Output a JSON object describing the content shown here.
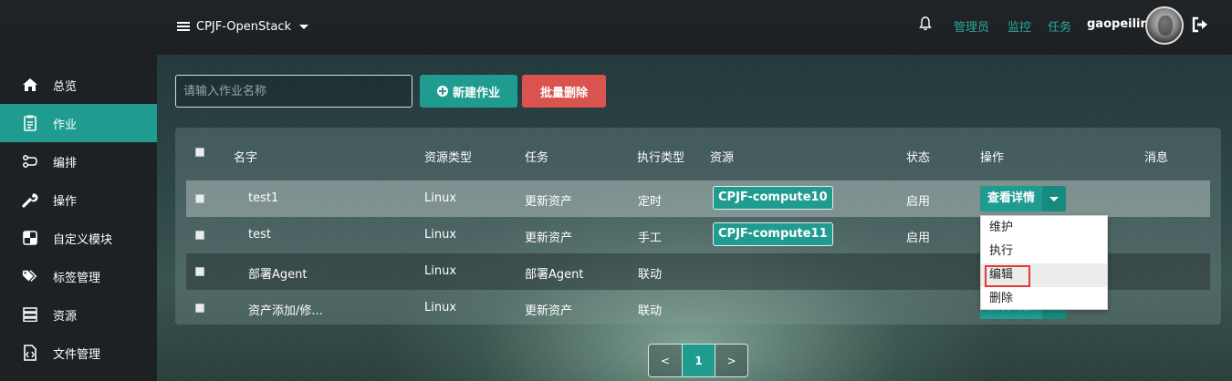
{
  "header": {
    "project_name": "CPJF-OpenStack",
    "links": [
      "管理员",
      "监控",
      "任务"
    ],
    "username": "gaopeilin"
  },
  "sidebar": {
    "items": [
      {
        "label": "总览",
        "icon": "home-icon"
      },
      {
        "label": "作业",
        "icon": "clipboard-icon",
        "active": true
      },
      {
        "label": "编排",
        "icon": "flow-icon"
      },
      {
        "label": "操作",
        "icon": "wrench-icon"
      },
      {
        "label": "自定义模块",
        "icon": "puzzle-icon"
      },
      {
        "label": "标签管理",
        "icon": "tags-icon"
      },
      {
        "label": "资源",
        "icon": "server-icon"
      },
      {
        "label": "文件管理",
        "icon": "file-code-icon"
      }
    ]
  },
  "toolbar": {
    "search_placeholder": "请输入作业名称",
    "new_label": "新建作业",
    "batch_delete_label": "批量删除"
  },
  "table": {
    "headers": {
      "name": "名字",
      "resource_type": "资源类型",
      "task": "任务",
      "exec_type": "执行类型",
      "resource": "资源",
      "status": "状态",
      "action": "操作",
      "message": "消息"
    },
    "rows": [
      {
        "name": "test1",
        "resource_type": "Linux",
        "task": "更新资产",
        "exec_type": "定时",
        "resource": "CPJF-compute10",
        "status": "启用",
        "action": "查看详情"
      },
      {
        "name": "test",
        "resource_type": "Linux",
        "task": "更新资产",
        "exec_type": "手工",
        "resource": "CPJF-compute11",
        "status": "启用",
        "action": ""
      },
      {
        "name": "部署Agent",
        "resource_type": "Linux",
        "task": "部署Agent",
        "exec_type": "联动",
        "resource": "",
        "status": "",
        "action": ""
      },
      {
        "name": "资产添加/修...",
        "resource_type": "Linux",
        "task": "更新资产",
        "exec_type": "联动",
        "resource": "",
        "status": "",
        "action": "查看详情"
      }
    ]
  },
  "dropdown": {
    "items": [
      "维护",
      "执行",
      "编辑",
      "删除"
    ]
  },
  "pagination": {
    "prev": "<",
    "current": "1",
    "next": ">"
  },
  "colors": {
    "accent": "#1f9c8f",
    "danger": "#d9534f",
    "link": "#2aa89a"
  }
}
